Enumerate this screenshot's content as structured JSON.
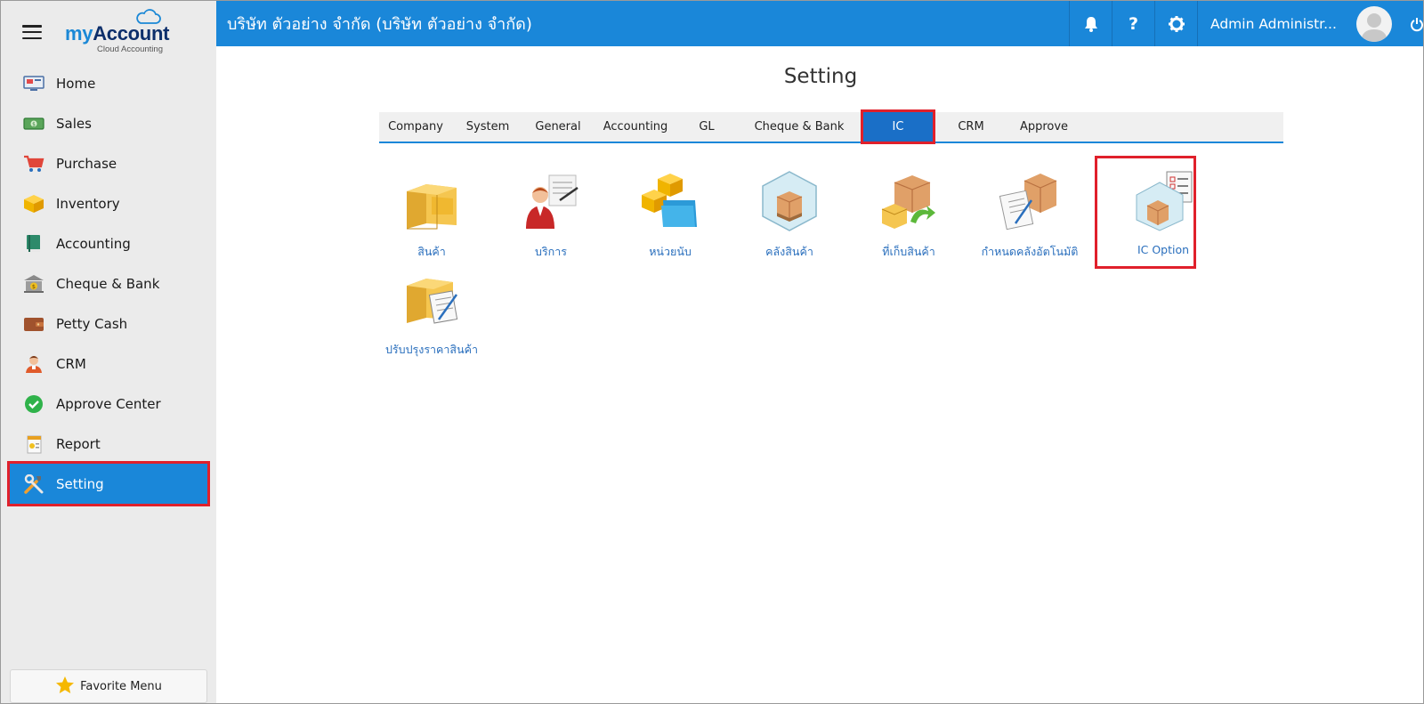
{
  "logo": {
    "brand_my": "my",
    "brand_account": "Account",
    "tagline": "Cloud Accounting"
  },
  "sidebar": {
    "items": [
      {
        "label": "Home",
        "icon": "home-icon"
      },
      {
        "label": "Sales",
        "icon": "money-icon"
      },
      {
        "label": "Purchase",
        "icon": "cart-icon"
      },
      {
        "label": "Inventory",
        "icon": "box-icon"
      },
      {
        "label": "Accounting",
        "icon": "book-icon"
      },
      {
        "label": "Cheque & Bank",
        "icon": "bank-icon"
      },
      {
        "label": "Petty Cash",
        "icon": "wallet-icon"
      },
      {
        "label": "CRM",
        "icon": "customer-icon"
      },
      {
        "label": "Approve Center",
        "icon": "check-circle-icon"
      },
      {
        "label": "Report",
        "icon": "report-icon"
      },
      {
        "label": "Setting",
        "icon": "tools-icon",
        "active": true
      }
    ],
    "favorite_label": "Favorite Menu"
  },
  "topbar": {
    "company": "บริษัท ตัวอย่าง จำกัด (บริษัท ตัวอย่าง จำกัด)",
    "help_label": "?",
    "user_name": "Admin Administr..."
  },
  "main": {
    "title": "Setting",
    "tabs": [
      {
        "label": "Company"
      },
      {
        "label": "System"
      },
      {
        "label": "General"
      },
      {
        "label": "Accounting"
      },
      {
        "label": "GL"
      },
      {
        "label": "Cheque & Bank"
      },
      {
        "label": "IC",
        "active": true
      },
      {
        "label": "CRM"
      },
      {
        "label": "Approve"
      }
    ],
    "tiles": [
      {
        "label": "สินค้า",
        "icon": "product-boxes-icon"
      },
      {
        "label": "บริการ",
        "icon": "service-agent-icon"
      },
      {
        "label": "หน่วยนับ",
        "icon": "unit-folder-icon"
      },
      {
        "label": "คลังสินค้า",
        "icon": "warehouse-icon"
      },
      {
        "label": "ที่เก็บสินค้า",
        "icon": "storage-location-icon"
      },
      {
        "label": "กำหนดคลังอัตโนมัติ",
        "icon": "auto-warehouse-icon"
      },
      {
        "label": "IC Option",
        "icon": "ic-option-icon",
        "highlighted": true
      },
      {
        "label": "ปรับปรุงราคาสินค้า",
        "icon": "price-adjust-icon"
      }
    ]
  },
  "colors": {
    "primary": "#1a87d9",
    "highlight": "#e0202b",
    "sidebar_bg": "#ebebeb",
    "link": "#2a6fbd"
  }
}
